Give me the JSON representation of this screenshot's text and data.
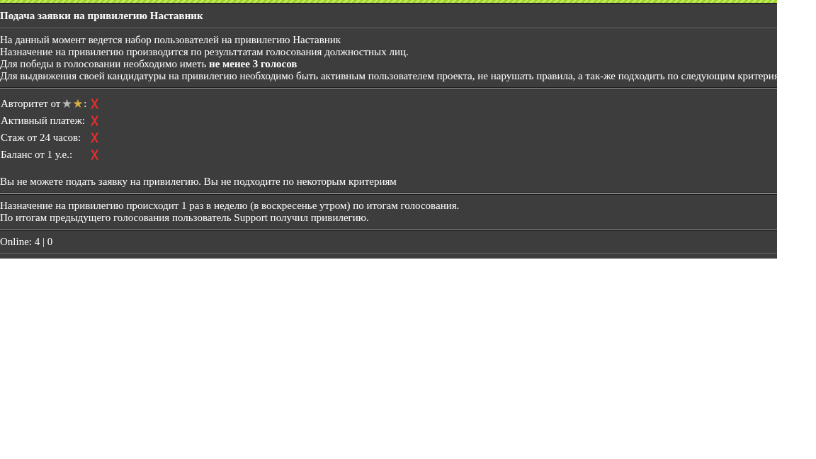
{
  "header": {
    "title": "Подача заявки на привилегию Наставник"
  },
  "intro": {
    "lines": [
      "На данный момент ведется набор пользователей на привилегию Наставник",
      "Назначение на привилегию производится по результтатам голосования должностных лиц.",
      "Для победы в голосовании необходимо иметь **не менее 3 голосов**",
      "Для выдвижения своей кандидатуры на привилегию необходимо быть активным пользователем проекта, не нарушать правила, а так-же подходить по следующим критерия"
    ]
  },
  "criteria": [
    {
      "kind": "rank",
      "label": "Авторитет от",
      "suffix": ":",
      "met": false
    },
    {
      "kind": "text",
      "label": "Активный платеж:",
      "met": false
    },
    {
      "kind": "text",
      "label": "Стаж от 24 часов:",
      "met": false
    },
    {
      "kind": "text",
      "label": "Баланс от 1 у.е.:",
      "met": false
    }
  ],
  "result": {
    "message": "Вы не можете подать заявку на привилегию. Вы не подходите по некоторым критериям"
  },
  "info": {
    "lines": [
      "Назначение на привилегию происходит 1 раз в неделю (в воскресенье утром) по итогам голосования.",
      "По итогам предыдущего голосования пользователь Support получил привилегию."
    ]
  },
  "footer": {
    "online": "Online: 4 | 0"
  }
}
